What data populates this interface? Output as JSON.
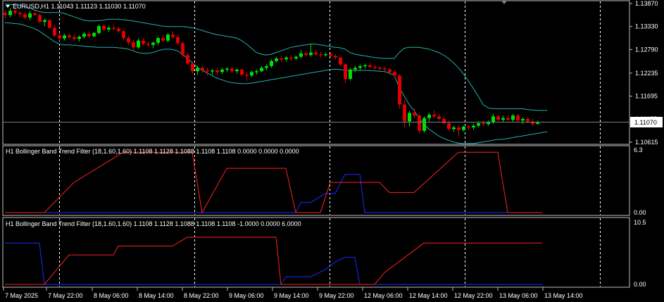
{
  "colors": {
    "background": "#000000",
    "frame": "#c0c0c0",
    "grid": "#ffffff",
    "bull": "#00e000",
    "bear": "#e00000",
    "bands": "#20b2aa",
    "red_line": "#ff2020",
    "blue_line": "#1a2cff",
    "current_price_line": "#708090"
  },
  "main_panel": {
    "title": "EURUSD,H1  1.11043 1.11123 1.11030 1.11070",
    "collapse_icon": "triangle-down-icon",
    "price_levels": [
      "1.13870",
      "1.13330",
      "1.12790",
      "1.12235",
      "1.11695",
      "1.11155",
      "1.10615"
    ],
    "current_price": "1.11070"
  },
  "indicator_1": {
    "title": "H1 Bollinger Band Trend Filter (18,1.60,1.60) 1.1108 1.1128 1.1088 1.1108 1.1108 0.0000 0.0000 0.0000",
    "scale_max": "6.3",
    "scale_min": "0.00"
  },
  "indicator_2": {
    "title": "H1 Bollinger Band Trend Filter (18,1.60,1.60) 1.1108 1.1128 1.1088 1.1108 1.1108 -1.0000 0.0000 6.0000",
    "scale_max": "10.5",
    "scale_min": "0.00"
  },
  "time_axis": [
    "7 May 2025",
    "7 May 22:00",
    "8 May 06:00",
    "8 May 14:00",
    "8 May 22:00",
    "9 May 06:00",
    "9 May 14:00",
    "9 May 22:00",
    "12 May 06:00",
    "12 May 14:00",
    "12 May 22:00",
    "13 May 06:00",
    "13 May 14:00"
  ],
  "chart_data": {
    "type": "candlestick",
    "symbol": "EURUSD",
    "timeframe": "H1",
    "ylim": [
      1.1058,
      1.1392
    ],
    "candles": [
      [
        1.1365,
        1.1372,
        1.1352,
        1.136
      ],
      [
        1.136,
        1.1376,
        1.1355,
        1.137
      ],
      [
        1.137,
        1.1378,
        1.136,
        1.1365
      ],
      [
        1.1365,
        1.137,
        1.1355,
        1.1362
      ],
      [
        1.1362,
        1.1368,
        1.135,
        1.1354
      ],
      [
        1.1354,
        1.137,
        1.1348,
        1.1364
      ],
      [
        1.1364,
        1.137,
        1.1358,
        1.136
      ],
      [
        1.136,
        1.1364,
        1.134,
        1.1344
      ],
      [
        1.1344,
        1.1352,
        1.1334,
        1.1348
      ],
      [
        1.1348,
        1.135,
        1.1328,
        1.133
      ],
      [
        1.133,
        1.1336,
        1.1308,
        1.1312
      ],
      [
        1.1312,
        1.1318,
        1.13,
        1.1305
      ],
      [
        1.1305,
        1.1316,
        1.13,
        1.1312
      ],
      [
        1.1312,
        1.1318,
        1.1304,
        1.1308
      ],
      [
        1.1308,
        1.1314,
        1.13,
        1.1304
      ],
      [
        1.1304,
        1.1312,
        1.1298,
        1.1309
      ],
      [
        1.1309,
        1.132,
        1.1305,
        1.1316
      ],
      [
        1.1316,
        1.1322,
        1.1305,
        1.131
      ],
      [
        1.131,
        1.132,
        1.1308,
        1.1318
      ],
      [
        1.1318,
        1.1338,
        1.1314,
        1.1334
      ],
      [
        1.1334,
        1.134,
        1.1322,
        1.1326
      ],
      [
        1.1326,
        1.1334,
        1.132,
        1.133
      ],
      [
        1.133,
        1.1338,
        1.1324,
        1.1328
      ],
      [
        1.1328,
        1.1332,
        1.1318,
        1.1322
      ],
      [
        1.1322,
        1.1326,
        1.13,
        1.1306
      ],
      [
        1.1306,
        1.1312,
        1.129,
        1.1296
      ],
      [
        1.1296,
        1.1302,
        1.1275,
        1.1284
      ],
      [
        1.1284,
        1.1305,
        1.128,
        1.13
      ],
      [
        1.13,
        1.1306,
        1.1288,
        1.1292
      ],
      [
        1.1292,
        1.1298,
        1.1285,
        1.129
      ],
      [
        1.129,
        1.1298,
        1.1282,
        1.1295
      ],
      [
        1.1295,
        1.131,
        1.129,
        1.1306
      ],
      [
        1.1306,
        1.1312,
        1.1296,
        1.13
      ],
      [
        1.13,
        1.1318,
        1.1296,
        1.1314
      ],
      [
        1.1314,
        1.1322,
        1.1304,
        1.1308
      ],
      [
        1.1308,
        1.1314,
        1.129,
        1.1294
      ],
      [
        1.1294,
        1.1298,
        1.1262,
        1.1266
      ],
      [
        1.1266,
        1.1272,
        1.1242,
        1.1246
      ],
      [
        1.1246,
        1.125,
        1.1222,
        1.1228
      ],
      [
        1.1228,
        1.124,
        1.122,
        1.1236
      ],
      [
        1.1236,
        1.1242,
        1.1225,
        1.123
      ],
      [
        1.123,
        1.1236,
        1.1218,
        1.1228
      ],
      [
        1.1228,
        1.1234,
        1.122,
        1.123
      ],
      [
        1.123,
        1.1236,
        1.122,
        1.1226
      ],
      [
        1.1226,
        1.1236,
        1.1222,
        1.1232
      ],
      [
        1.1232,
        1.1238,
        1.1226,
        1.1234
      ],
      [
        1.1234,
        1.1238,
        1.1224,
        1.1228
      ],
      [
        1.1228,
        1.1234,
        1.1222,
        1.1232
      ],
      [
        1.1232,
        1.1234,
        1.1215,
        1.122
      ],
      [
        1.122,
        1.1226,
        1.1205,
        1.1218
      ],
      [
        1.1218,
        1.123,
        1.1214,
        1.1226
      ],
      [
        1.1226,
        1.1232,
        1.122,
        1.1228
      ],
      [
        1.1228,
        1.124,
        1.1226,
        1.1236
      ],
      [
        1.1236,
        1.1244,
        1.123,
        1.124
      ],
      [
        1.124,
        1.1256,
        1.1236,
        1.1252
      ],
      [
        1.1252,
        1.1262,
        1.1248,
        1.1258
      ],
      [
        1.1258,
        1.1264,
        1.125,
        1.1256
      ],
      [
        1.1256,
        1.1264,
        1.125,
        1.126
      ],
      [
        1.126,
        1.1266,
        1.1252,
        1.1258
      ],
      [
        1.1258,
        1.1264,
        1.1254,
        1.1262
      ],
      [
        1.1262,
        1.1278,
        1.1258,
        1.127
      ],
      [
        1.127,
        1.1276,
        1.1262,
        1.1266
      ],
      [
        1.1266,
        1.1292,
        1.1262,
        1.1272
      ],
      [
        1.1272,
        1.1278,
        1.1264,
        1.1268
      ],
      [
        1.1268,
        1.1274,
        1.126,
        1.1266
      ],
      [
        1.1266,
        1.1272,
        1.1262,
        1.1268
      ],
      [
        1.1268,
        1.1272,
        1.126,
        1.1264
      ],
      [
        1.1264,
        1.1268,
        1.1256,
        1.126
      ],
      [
        1.126,
        1.1262,
        1.124,
        1.1244
      ],
      [
        1.1244,
        1.1248,
        1.12,
        1.121
      ],
      [
        1.121,
        1.1236,
        1.1206,
        1.1232
      ],
      [
        1.1232,
        1.124,
        1.1226,
        1.1236
      ],
      [
        1.1236,
        1.1244,
        1.123,
        1.124
      ],
      [
        1.124,
        1.1246,
        1.1234,
        1.1242
      ],
      [
        1.1242,
        1.1248,
        1.1236,
        1.1238
      ],
      [
        1.1238,
        1.1244,
        1.1232,
        1.1236
      ],
      [
        1.1236,
        1.124,
        1.123,
        1.1234
      ],
      [
        1.1234,
        1.1238,
        1.1228,
        1.1232
      ],
      [
        1.1232,
        1.1236,
        1.122,
        1.1226
      ],
      [
        1.1226,
        1.123,
        1.1212,
        1.1218
      ],
      [
        1.1218,
        1.1222,
        1.114,
        1.115
      ],
      [
        1.115,
        1.116,
        1.1095,
        1.111
      ],
      [
        1.111,
        1.1135,
        1.1098,
        1.113
      ],
      [
        1.113,
        1.114,
        1.1118,
        1.1124
      ],
      [
        1.1124,
        1.1126,
        1.1082,
        1.1088
      ],
      [
        1.1088,
        1.1122,
        1.1084,
        1.1118
      ],
      [
        1.1118,
        1.113,
        1.111,
        1.1126
      ],
      [
        1.1126,
        1.1136,
        1.1118,
        1.1122
      ],
      [
        1.1122,
        1.1128,
        1.1112,
        1.1116
      ],
      [
        1.1116,
        1.1122,
        1.1102,
        1.1106
      ],
      [
        1.1106,
        1.1112,
        1.1088,
        1.1092
      ],
      [
        1.1092,
        1.11,
        1.1085,
        1.1096
      ],
      [
        1.1096,
        1.1102,
        1.1076,
        1.109
      ],
      [
        1.109,
        1.11,
        1.1086,
        1.1098
      ],
      [
        1.1098,
        1.1102,
        1.109,
        1.1096
      ],
      [
        1.1096,
        1.1104,
        1.109,
        1.11
      ],
      [
        1.11,
        1.111,
        1.1096,
        1.1106
      ],
      [
        1.1106,
        1.1112,
        1.11,
        1.1104
      ],
      [
        1.1104,
        1.1112,
        1.11,
        1.1108
      ],
      [
        1.1108,
        1.1128,
        1.1104,
        1.1122
      ],
      [
        1.1122,
        1.1126,
        1.111,
        1.1114
      ],
      [
        1.1114,
        1.1124,
        1.1108,
        1.1118
      ],
      [
        1.1118,
        1.1126,
        1.1112,
        1.1114
      ],
      [
        1.1114,
        1.1128,
        1.1108,
        1.1124
      ],
      [
        1.1124,
        1.1128,
        1.111,
        1.1112
      ],
      [
        1.1112,
        1.112,
        1.1104,
        1.1116
      ],
      [
        1.1116,
        1.112,
        1.1106,
        1.111
      ],
      [
        1.111,
        1.1116,
        1.11,
        1.1104
      ],
      [
        1.1104,
        1.1112,
        1.1103,
        1.1107
      ]
    ],
    "upper_band": [
      1.1386,
      1.1385,
      1.1384,
      1.1383,
      1.138,
      1.1376,
      1.1372,
      1.1368,
      1.1366,
      1.1366,
      1.1366,
      1.1366,
      1.1364,
      1.136,
      1.1356,
      1.1352,
      1.1348,
      1.1346,
      1.1346,
      1.1347,
      1.1348,
      1.135,
      1.135,
      1.135,
      1.1349,
      1.1348,
      1.1346,
      1.1344,
      1.1342,
      1.134,
      1.1338,
      1.1336,
      1.1334,
      1.1333,
      1.1333,
      1.1333,
      1.1333,
      1.1332,
      1.133,
      1.1327,
      1.1324,
      1.132,
      1.1317,
      1.1314,
      1.1312,
      1.131,
      1.1308,
      1.1306,
      1.13,
      1.1292,
      1.1282,
      1.1272,
      1.1268,
      1.1266,
      1.1268,
      1.1272,
      1.1276,
      1.128,
      1.1284,
      1.1286,
      1.1288,
      1.129,
      1.1292,
      1.1292,
      1.129,
      1.1288,
      1.1286,
      1.1284,
      1.1283,
      1.128,
      1.1272,
      1.1268,
      1.1266,
      1.1264,
      1.1262,
      1.126,
      1.1259,
      1.1258,
      1.1258,
      1.1258,
      1.1272,
      1.1282,
      1.1284,
      1.1284,
      1.1284,
      1.1282,
      1.128,
      1.1276,
      1.1272,
      1.1266,
      1.1258,
      1.1248,
      1.1236,
      1.1222,
      1.1206,
      1.1188,
      1.117,
      1.115,
      1.1142,
      1.114,
      1.114,
      1.114,
      1.114,
      1.114,
      1.114,
      1.114,
      1.1138,
      1.1137,
      1.1136,
      1.1136,
      1.1136
    ],
    "middle_band": [
      1.1364,
      1.1363,
      1.1362,
      1.1361,
      1.1359,
      1.1356,
      1.1353,
      1.135,
      1.1346,
      1.1342,
      1.1338,
      1.1334,
      1.133,
      1.1326,
      1.1322,
      1.1318,
      1.1316,
      1.1314,
      1.1313,
      1.1313,
      1.1314,
      1.1316,
      1.1317,
      1.1317,
      1.1316,
      1.1314,
      1.1312,
      1.131,
      1.1308,
      1.1306,
      1.1305,
      1.1305,
      1.1306,
      1.1307,
      1.1306,
      1.1304,
      1.13,
      1.1296,
      1.129,
      1.1284,
      1.1278,
      1.1272,
      1.1266,
      1.126,
      1.1255,
      1.125,
      1.1246,
      1.1242,
      1.1238,
      1.1234,
      1.1232,
      1.123,
      1.123,
      1.1231,
      1.1233,
      1.1236,
      1.124,
      1.1244,
      1.1248,
      1.1251,
      1.1254,
      1.1257,
      1.1259,
      1.1261,
      1.1262,
      1.1262,
      1.1262,
      1.1261,
      1.1259,
      1.1256,
      1.1252,
      1.1249,
      1.1247,
      1.1246,
      1.1245,
      1.1245,
      1.1244,
      1.1244,
      1.1242,
      1.124,
      1.1234,
      1.1226,
      1.1218,
      1.121,
      1.12,
      1.1192,
      1.1184,
      1.1176,
      1.1168,
      1.116,
      1.1152,
      1.1144,
      1.1136,
      1.1128,
      1.112,
      1.1113,
      1.1108,
      1.1104,
      1.1102,
      1.1101,
      1.1101,
      1.1102,
      1.1103,
      1.1105,
      1.1107,
      1.1108,
      1.1109,
      1.111,
      1.111,
      1.111,
      1.111
    ],
    "lower_band": [
      1.1342,
      1.1341,
      1.134,
      1.1339,
      1.1336,
      1.1332,
      1.1328,
      1.1322,
      1.1314,
      1.1306,
      1.1298,
      1.1292,
      1.129,
      1.129,
      1.1289,
      1.1288,
      1.1287,
      1.1286,
      1.1285,
      1.1284,
      1.1284,
      1.1284,
      1.1284,
      1.1283,
      1.1282,
      1.128,
      1.1276,
      1.1272,
      1.127,
      1.127,
      1.1272,
      1.1276,
      1.1279,
      1.128,
      1.1279,
      1.1276,
      1.1268,
      1.1258,
      1.1248,
      1.1238,
      1.123,
      1.1224,
      1.1218,
      1.1212,
      1.1208,
      1.1204,
      1.1201,
      1.12,
      1.1199,
      1.1199,
      1.12,
      1.1202,
      1.1204,
      1.1206,
      1.1208,
      1.121,
      1.1212,
      1.1214,
      1.1216,
      1.1218,
      1.122,
      1.1222,
      1.1224,
      1.1226,
      1.1228,
      1.123,
      1.1232,
      1.1233,
      1.1232,
      1.123,
      1.123,
      1.123,
      1.123,
      1.123,
      1.123,
      1.1229,
      1.1228,
      1.1227,
      1.1224,
      1.1218,
      1.119,
      1.117,
      1.115,
      1.1136,
      1.1118,
      1.1104,
      1.1092,
      1.1084,
      1.1076,
      1.107,
      1.1066,
      1.1062,
      1.1059,
      1.1058,
      1.1058,
      1.1058,
      1.106,
      1.1062,
      1.1064,
      1.1066,
      1.1068,
      1.1068,
      1.107,
      1.1072,
      1.1074,
      1.1076,
      1.1078,
      1.108,
      1.1082,
      1.1084,
      1.1086
    ],
    "indicator_1_lines": {
      "ylim": [
        0,
        6.3
      ],
      "red": {
        "x": [
          0,
          8,
          14,
          24,
          25,
          27,
          28,
          30,
          37,
          38,
          40,
          45,
          47,
          55,
          57,
          59,
          63,
          64,
          66,
          74,
          76,
          78,
          83,
          92,
          99,
          100,
          102,
          109
        ],
        "y": [
          0,
          0,
          3,
          6,
          6,
          6,
          6,
          6,
          6,
          6,
          0,
          4.4,
          4.4,
          4.4,
          4.4,
          0,
          0,
          0,
          3,
          3,
          3,
          2,
          2,
          6,
          6,
          6,
          0,
          0
        ]
      },
      "blue": {
        "x": [
          0,
          55,
          56,
          59,
          60,
          62,
          65,
          67,
          69,
          70,
          72,
          73,
          109
        ],
        "y": [
          0,
          0,
          0,
          0,
          1,
          1,
          1.9,
          1.9,
          3.8,
          3.8,
          3.8,
          0,
          0
        ]
      }
    },
    "indicator_2_lines": {
      "ylim": [
        0,
        10.5
      ],
      "red": {
        "x": [
          0,
          8,
          13,
          22,
          23,
          34,
          37,
          55,
          56,
          75,
          77,
          85,
          87,
          109
        ],
        "y": [
          0,
          0,
          5,
          5,
          6.5,
          6.5,
          8,
          8,
          0,
          0,
          2,
          7,
          7,
          7
        ]
      },
      "blue": {
        "x": [
          0,
          7,
          8,
          56,
          57,
          62,
          65,
          67,
          69,
          71,
          72,
          109
        ],
        "y": [
          7,
          7,
          0,
          0,
          1.3,
          1.3,
          2.5,
          3.8,
          4.6,
          4.6,
          0,
          0
        ]
      }
    }
  }
}
